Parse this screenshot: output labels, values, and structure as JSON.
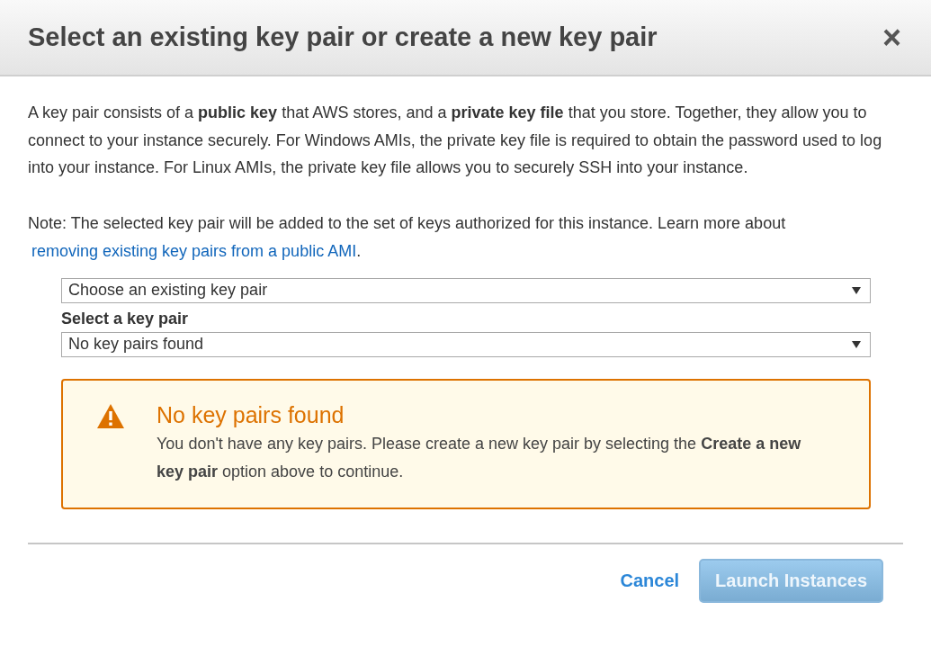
{
  "dialog": {
    "title": "Select an existing key pair or create a new key pair",
    "close": "×"
  },
  "intro": "A key pair consists of a **public key** that AWS stores, and a **private key file** that you store. Together, they allow you to connect to your instance securely. For Windows AMIs, the private key file is required to obtain the password used to log into your instance. For Linux AMIs, the private key file allows you to securely SSH into your instance.",
  "note": {
    "text": "Note: The selected key pair will be added to the set of keys authorized for this instance. Learn more about",
    "link": "removing existing key pairs from a public AMI",
    "after": "."
  },
  "mode_select": {
    "value": "Choose an existing key pair"
  },
  "key_select": {
    "label": "Select a key pair",
    "value": "No key pairs found"
  },
  "warning": {
    "title": "No key pairs found",
    "message": "You don't have any key pairs. Please create a new key pair by selecting the **Create a new key pair** option above to continue."
  },
  "buttons": {
    "cancel": "Cancel",
    "launch": {
      "label": "Launch Instances",
      "disabled": true
    }
  }
}
